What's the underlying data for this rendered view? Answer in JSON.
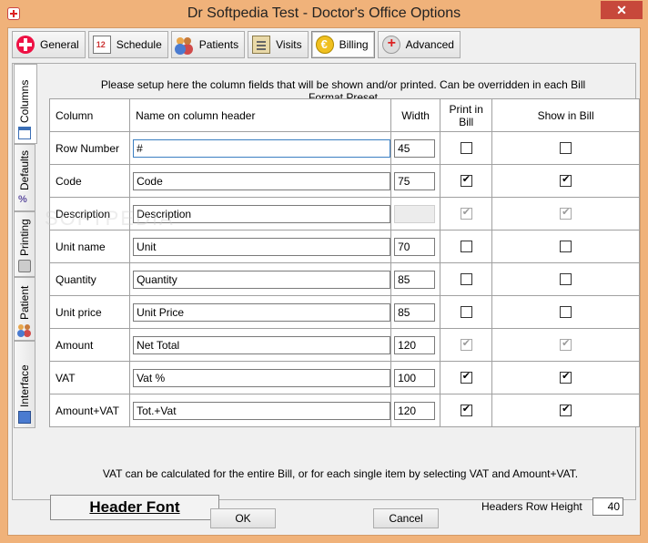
{
  "window": {
    "title": "Dr Softpedia Test - Doctor's Office Options",
    "close_glyph": "✕"
  },
  "tabs": [
    {
      "label": "General",
      "icon": "general-icon"
    },
    {
      "label": "Schedule",
      "icon": "calendar-icon"
    },
    {
      "label": "Patients",
      "icon": "patients-icon"
    },
    {
      "label": "Visits",
      "icon": "clipboard-icon"
    },
    {
      "label": "Billing",
      "icon": "euro-coin-icon",
      "active": true
    },
    {
      "label": "Advanced",
      "icon": "advanced-icon"
    }
  ],
  "side_tabs": [
    {
      "label": "Columns",
      "icon": "columns-icon",
      "active": true
    },
    {
      "label": "Defaults",
      "icon": "percent-icon"
    },
    {
      "label": "Printing",
      "icon": "printer-icon"
    },
    {
      "label": "Patient",
      "icon": "patients-icon"
    },
    {
      "label": "Interface",
      "icon": "monitor-icon"
    }
  ],
  "intro_text": "Please setup here the column fields that will be shown and/or printed. Can be overridden in each Bill Format Preset",
  "table": {
    "headers": [
      "Column",
      "Name on column header",
      "Width",
      "Print in Bill",
      "Show in Bill"
    ],
    "rows": [
      {
        "column": "Row Number",
        "name": "#",
        "width": "45",
        "print": false,
        "show": false
      },
      {
        "column": "Code",
        "name": "Code",
        "width": "75",
        "print": true,
        "show": true
      },
      {
        "column": "Description",
        "name": "Description",
        "width": "",
        "print": true,
        "show": true,
        "locked": true
      },
      {
        "column": "Unit name",
        "name": "Unit",
        "width": "70",
        "print": false,
        "show": false
      },
      {
        "column": "Quantity",
        "name": "Quantity",
        "width": "85",
        "print": false,
        "show": false
      },
      {
        "column": "Unit price",
        "name": "Unit Price",
        "width": "85",
        "print": false,
        "show": false
      },
      {
        "column": "Amount",
        "name": "Net Total",
        "width": "120",
        "print": true,
        "show": true,
        "locked": true
      },
      {
        "column": "VAT",
        "name": "Vat %",
        "width": "100",
        "print": true,
        "show": true
      },
      {
        "column": "Amount+VAT",
        "name": "Tot.+Vat",
        "width": "120",
        "print": true,
        "show": true
      }
    ]
  },
  "vat_note": "VAT can be calculated for the entire Bill, or for each single item by selecting VAT and Amount+VAT.",
  "header_font_label": "Header Font",
  "header_row_height": {
    "label": "Headers Row Height",
    "value": "40"
  },
  "buttons": {
    "ok": "OK",
    "cancel": "Cancel"
  },
  "watermark": "SOFTPEDIA"
}
